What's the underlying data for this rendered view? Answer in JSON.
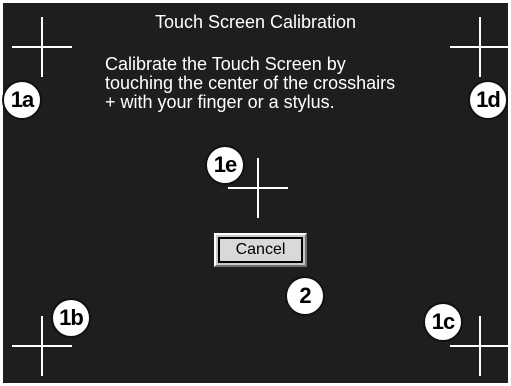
{
  "window": {
    "title": "Touch Screen Calibration"
  },
  "instructions": {
    "line1": "Calibrate the Touch Screen by",
    "line2": "touching the center of the crosshairs",
    "line3": "+ with your finger or a stylus."
  },
  "buttons": {
    "cancel_label": "Cancel"
  },
  "callouts": {
    "top_left": "1a",
    "bottom_left": "1b",
    "bottom_right": "1c",
    "top_right": "1d",
    "center": "1e",
    "cancel": "2"
  },
  "colors": {
    "screen_background": "#201d1e",
    "text": "#ffffff",
    "button_face": "#d9d9d9"
  }
}
